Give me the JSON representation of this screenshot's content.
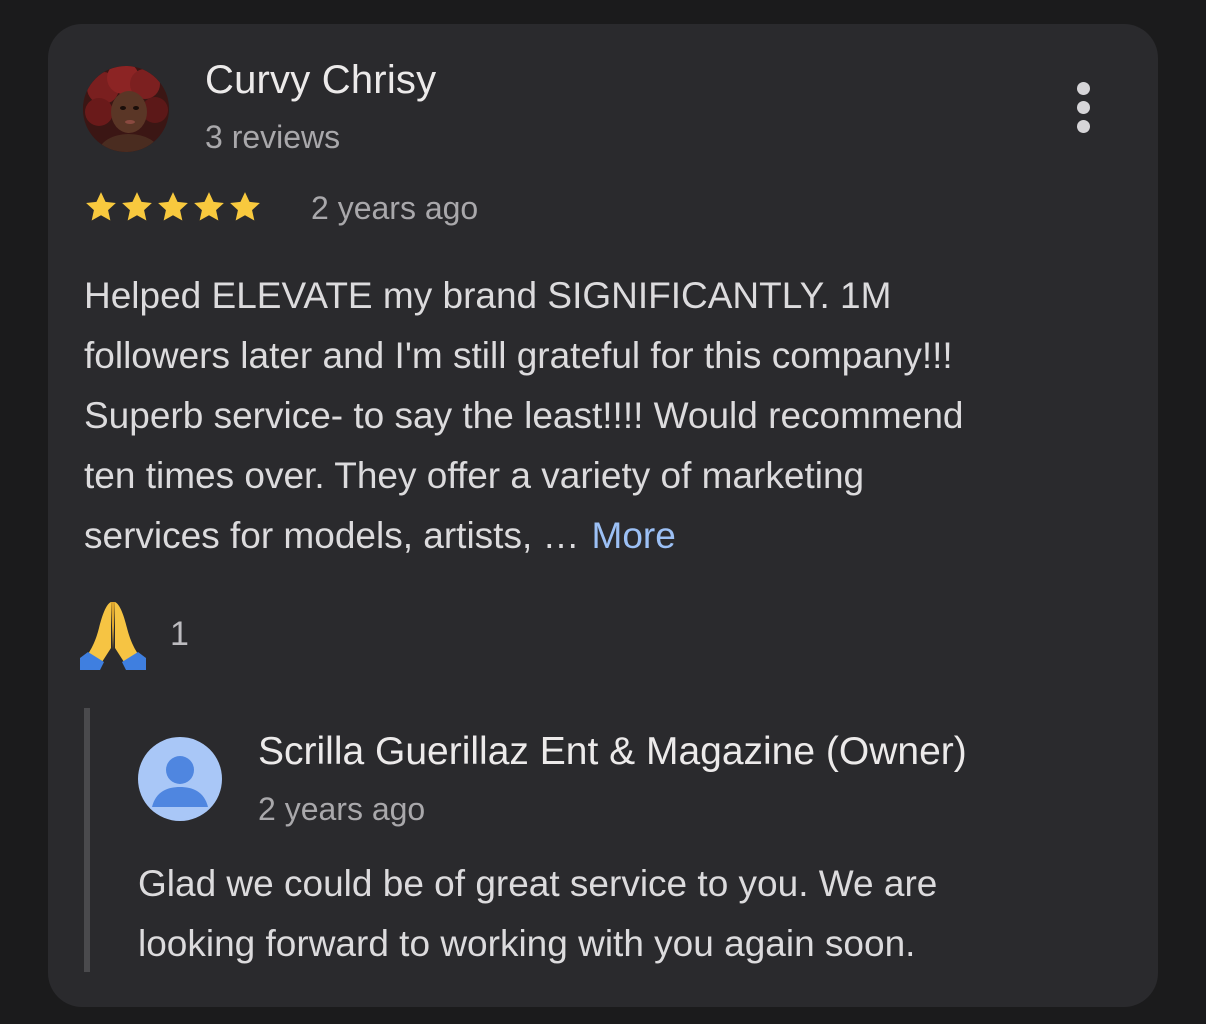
{
  "review": {
    "reviewer_name": "Curvy Chrisy",
    "review_count": "3 reviews",
    "rating": 5,
    "max_rating": 5,
    "date": "2 years ago",
    "text_lines": [
      "Helped ELEVATE my brand SIGNIFICANTLY. 1M",
      "followers later and I'm still grateful for this company!!!",
      "Superb service- to say the least!!!! Would recommend",
      "ten times over. They offer a variety of marketing",
      "services for models, artists, …"
    ],
    "more_label": "More",
    "reaction_count": "1"
  },
  "owner_reply": {
    "name": "Scrilla Guerillaz Ent & Magazine (Owner)",
    "date": "2 years ago",
    "text_lines": [
      "Glad we could be of great service to you. We are",
      "looking forward to working with you again soon."
    ]
  },
  "colors": {
    "background": "#1b1b1c",
    "card": "#2a2a2d",
    "star": "#f8c93e",
    "link": "#9cc0f5",
    "owner_avatar": "#a9c7f7",
    "owner_avatar_icon": "#4f86e0"
  },
  "icons": {
    "menu": "more-vert-icon",
    "star": "star-icon",
    "reaction": "folded-hands-icon",
    "owner_avatar": "person-icon"
  }
}
